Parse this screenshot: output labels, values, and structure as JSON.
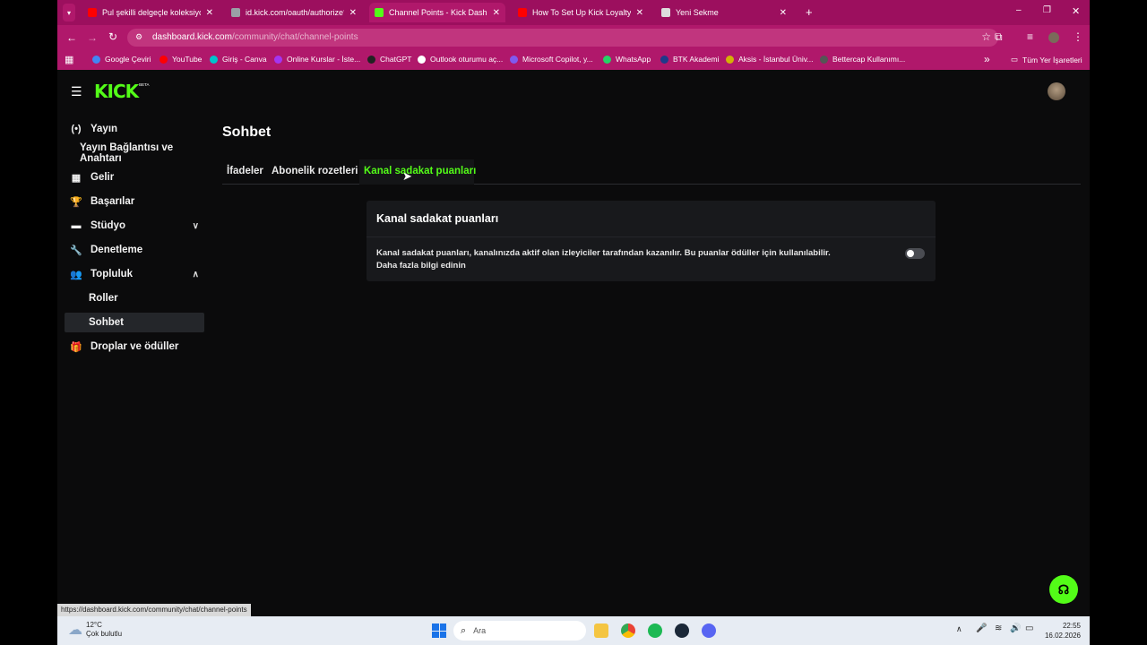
{
  "browser": {
    "tabs": [
      {
        "title": "Pul şekilli delgeçle koleksiyon y",
        "favicon_color": "#ff0000",
        "active": false
      },
      {
        "title": "id.kick.com/oauth/authorize?cli",
        "favicon_color": "#9aa0a6",
        "active": false
      },
      {
        "title": "Channel Points - Kick Dashboa",
        "favicon_color": "#53fc18",
        "active": true
      },
      {
        "title": "How To Set Up Kick Loyalty Poi",
        "favicon_color": "#ff0000",
        "active": false
      },
      {
        "title": "Yeni Sekme",
        "favicon_color": "#dddddd",
        "active": false
      }
    ],
    "new_tab": "+",
    "window_controls": {
      "minimize": "–",
      "restore": "❐",
      "close": "✕"
    },
    "url_host": "dashboard.kick.com",
    "url_path": "/community/chat/channel-points",
    "bookmarks": [
      {
        "label": "Google Çeviri",
        "color": "#4285f4"
      },
      {
        "label": "YouTube",
        "color": "#ff0000"
      },
      {
        "label": "Giriş - Canva",
        "color": "#00c4cc"
      },
      {
        "label": "Online Kurslar - İste...",
        "color": "#a435f0"
      },
      {
        "label": "ChatGPT",
        "color": "#222222"
      },
      {
        "label": "Outlook oturumu aç...",
        "color": "#ffffff"
      },
      {
        "label": "Microsoft Copilot, y...",
        "color": "#7f5af0"
      },
      {
        "label": "WhatsApp",
        "color": "#25d366"
      },
      {
        "label": "BTK Akademi",
        "color": "#1e3a8a"
      },
      {
        "label": "Aksis - İstanbul Üniv...",
        "color": "#d4b106"
      },
      {
        "label": "Bettercap Kullanımı...",
        "color": "#555555"
      }
    ],
    "bookmarks_more": "»",
    "all_bookmarks": "Tüm Yer İşaretleri",
    "status_url": "https://dashboard.kick.com/community/chat/channel-points"
  },
  "app": {
    "logo": "KICK",
    "logo_badge": "BETA",
    "accent": "#53fc18",
    "sidebar": [
      {
        "label": "Yayın",
        "icon": "broadcast-icon",
        "glyph": "(•)",
        "sub": false
      },
      {
        "label": "Yayın Bağlantısı ve Anahtarı",
        "icon": "",
        "glyph": "",
        "sub": true
      },
      {
        "label": "Gelir",
        "icon": "revenue-icon",
        "glyph": "▦",
        "sub": false
      },
      {
        "label": "Başarılar",
        "icon": "trophy-icon",
        "glyph": "🏆",
        "sub": false
      },
      {
        "label": "Stüdyo",
        "icon": "studio-icon",
        "glyph": "▬",
        "sub": false,
        "chevron": "∨"
      },
      {
        "label": "Denetleme",
        "icon": "wrench-icon",
        "glyph": "🔧",
        "sub": false
      },
      {
        "label": "Topluluk",
        "icon": "community-icon",
        "glyph": "👥",
        "sub": false,
        "chevron": "∧"
      },
      {
        "label": "Roller",
        "icon": "",
        "glyph": "",
        "sub": true
      },
      {
        "label": "Sohbet",
        "icon": "",
        "glyph": "",
        "sub": true,
        "active": true
      },
      {
        "label": "Droplar ve ödüller",
        "icon": "drops-icon",
        "glyph": "🎁",
        "sub": false
      }
    ],
    "page_title": "Sohbet",
    "tabs": [
      {
        "label": "İfadeler",
        "active": false
      },
      {
        "label": "Abonelik rozetleri",
        "active": false
      },
      {
        "label": "Kanal sadakat puanları",
        "active": true
      }
    ],
    "card": {
      "title": "Kanal sadakat puanları",
      "description": "Kanal sadakat puanları, kanalınızda aktif olan izleyiciler tarafından kazanılır. Bu puanlar ödüller için kullanılabilir.",
      "link": "Daha fazla bilgi edinin",
      "toggle_on": false
    }
  },
  "taskbar": {
    "weather_temp": "12°C",
    "weather_text": "Çok bulutlu",
    "search_placeholder": "Ara",
    "time": "22:55",
    "date": "16.02.2026"
  }
}
